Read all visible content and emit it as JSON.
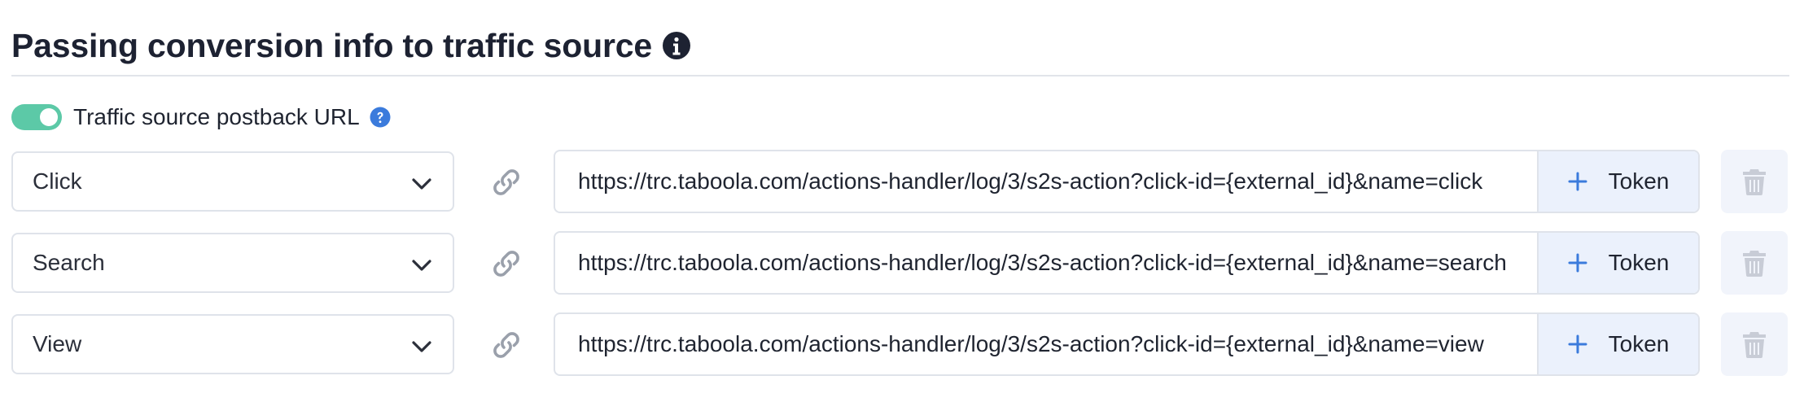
{
  "section": {
    "title": "Passing conversion info to traffic source"
  },
  "postback": {
    "toggle_label": "Traffic source postback URL",
    "enabled": true
  },
  "rows": [
    {
      "event": "Click",
      "url": "https://trc.taboola.com/actions-handler/log/3/s2s-action?click-id={external_id}&name=click",
      "token_label": "Token"
    },
    {
      "event": "Search",
      "url": "https://trc.taboola.com/actions-handler/log/3/s2s-action?click-id={external_id}&name=search",
      "token_label": "Token"
    },
    {
      "event": "View",
      "url": "https://trc.taboola.com/actions-handler/log/3/s2s-action?click-id={external_id}&name=view",
      "token_label": "Token"
    }
  ],
  "icons": {
    "info": "info-circle-icon",
    "help": "question-circle-icon",
    "select": "chevron-down-icon",
    "link": "link-icon",
    "add": "plus-icon",
    "delete": "trash-icon"
  },
  "colors": {
    "toggle_on": "#5cc9a7",
    "token_bg": "#ebf1fc",
    "accent": "#3b7bdc",
    "muted_icon": "#c8ccd6"
  }
}
